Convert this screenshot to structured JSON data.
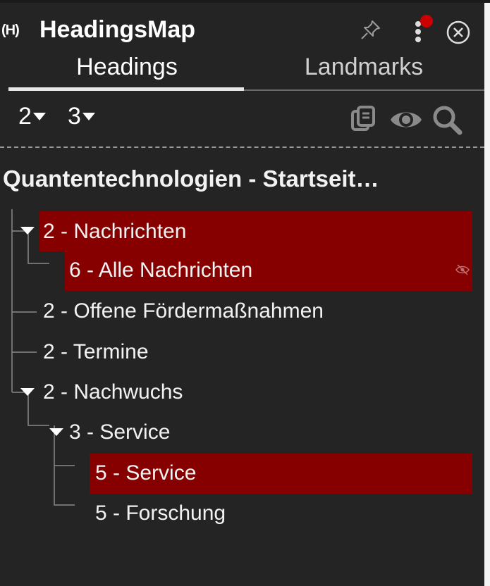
{
  "app": {
    "title": "HeadingsMap",
    "logo": "(H)"
  },
  "tabs": [
    {
      "label": "Headings"
    },
    {
      "label": "Landmarks"
    }
  ],
  "toolbar": {
    "level_a": "2",
    "level_b": "3"
  },
  "page_title": "Quantentechnologien - Startseit…",
  "tree": [
    {
      "text": "2 - Nachrichten"
    },
    {
      "text": "6 - Alle Nachrichten"
    },
    {
      "text": "2 - Offene Fördermaßnahmen"
    },
    {
      "text": "2 - Termine"
    },
    {
      "text": "2 - Nachwuchs"
    },
    {
      "text": "3 - Service"
    },
    {
      "text": "5 - Service"
    },
    {
      "text": "5 - Forschung"
    }
  ],
  "colors": {
    "panel_bg": "#242424",
    "highlight": "#870000",
    "notification_dot": "#cc0000"
  },
  "icons": [
    "pin-icon",
    "more-menu-icon",
    "close-icon",
    "copy-icon",
    "eye-icon",
    "search-icon",
    "eye-off-icon",
    "expand-toggle-icon"
  ]
}
